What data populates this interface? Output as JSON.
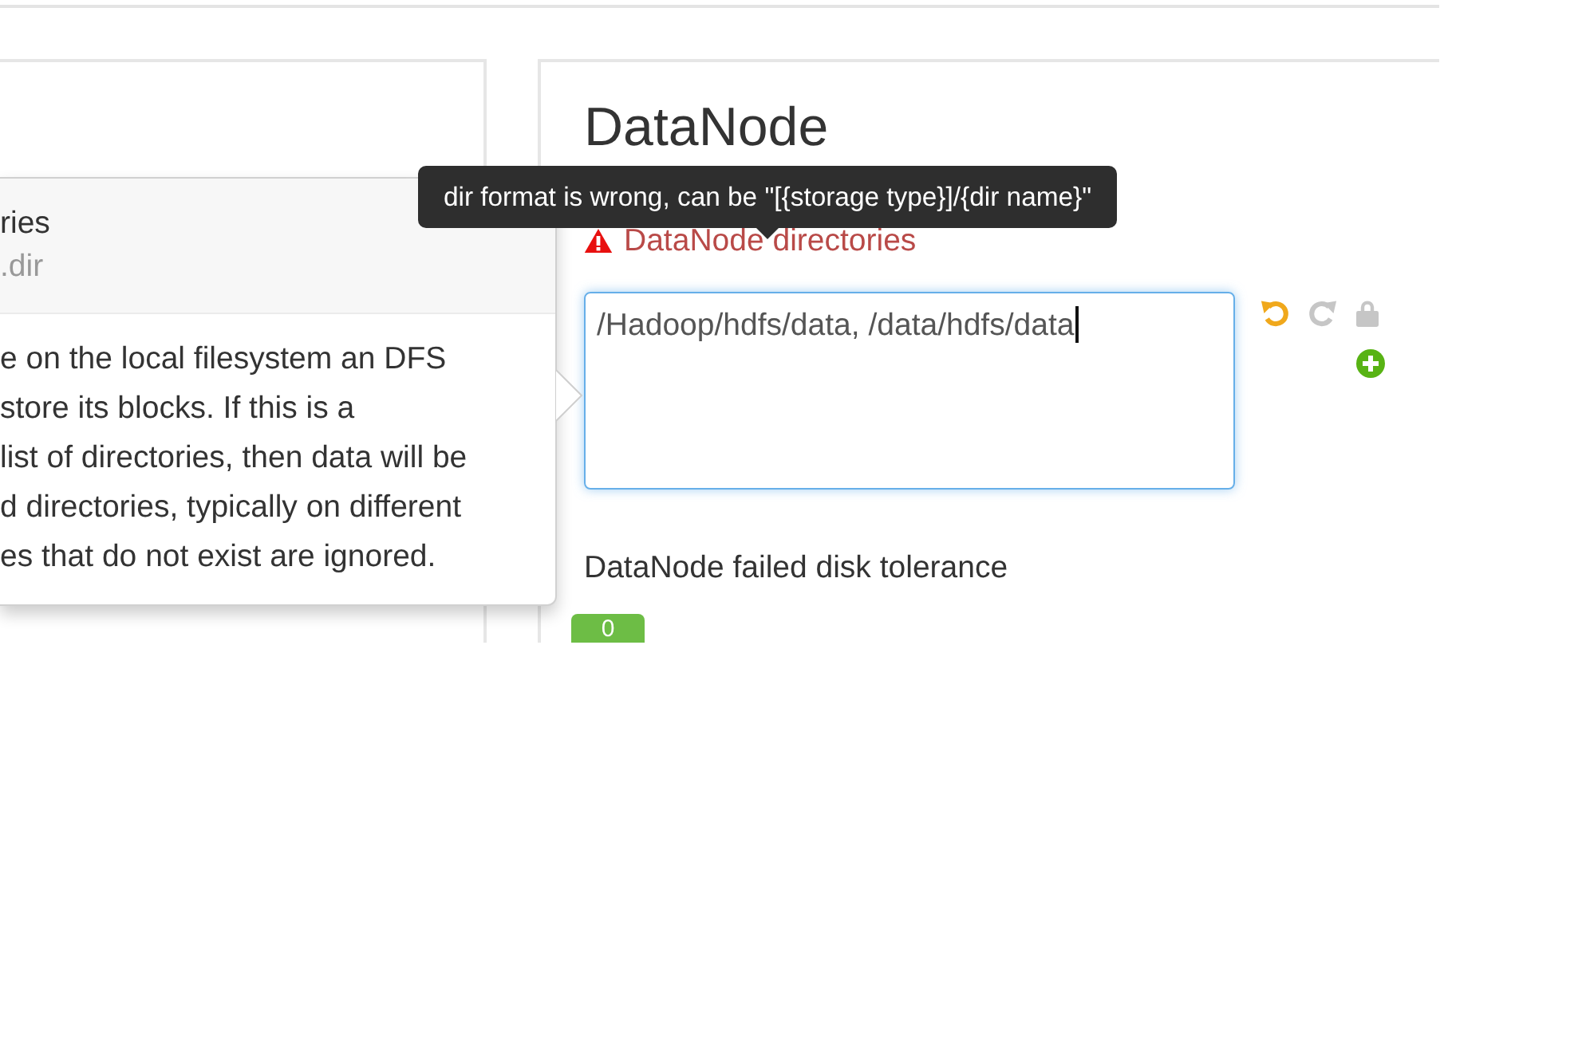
{
  "popover": {
    "title": "ries",
    "subtitle": ".dir",
    "lines": [
      "e on the local filesystem an DFS",
      "store its blocks. If this is a",
      "list of directories, then data will be",
      "d directories, typically on different",
      "es that do not exist are ignored."
    ]
  },
  "tooltip": {
    "text": "dir format is wrong, can be \"[{storage type}]/{dir name}\""
  },
  "panel": {
    "heading": "DataNode",
    "fields": [
      {
        "kind": "textarea",
        "label": "DataNode directories",
        "error": true,
        "focused": true,
        "value": "/Hadoop/hdfs/data, /data/hdfs/data",
        "actions": [
          {
            "kind": "undo",
            "disabled": false
          },
          {
            "kind": "redo",
            "disabled": true
          },
          {
            "kind": "lock",
            "disabled": true
          },
          {
            "kind": "add",
            "disabled": false
          }
        ]
      },
      {
        "kind": "badge",
        "label": "DataNode failed disk tolerance",
        "error": false,
        "value": "0"
      }
    ]
  }
}
